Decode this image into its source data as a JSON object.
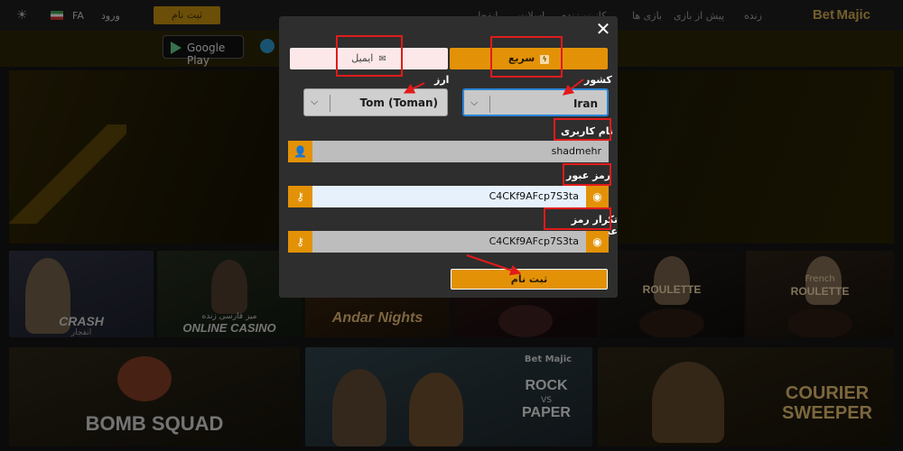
{
  "site": {
    "logo": "Bet Majic",
    "nav": [
      "زنده",
      "پیش از بازی",
      "بازی ها",
      "کازینو زنده",
      "اسلات",
      "انفجار"
    ],
    "register_button": "ثبت نام",
    "login_button": "ورود",
    "language": "FA",
    "google_play": "Google Play",
    "tiles": {
      "crash": "CRASH",
      "crash_sub": "انفجار",
      "online_casino": "ONLINE CASINO",
      "online_casino_sub": "میز فارسی زنده",
      "andar": "Andar Nights",
      "roulette2": "ROULETTE",
      "roulette3": "ROULETTE",
      "roulette3_top": "French",
      "bomb": "BOMB SQUAD",
      "rock_logo": "Bet Majic",
      "rock": "ROCK",
      "rock_vs": "VS",
      "paper": "PAPER",
      "courier": "COURIER",
      "sweeper": "SWEEPER"
    }
  },
  "modal": {
    "close": "✕",
    "tabs": {
      "email": "ایمیل",
      "fast": "سریع"
    },
    "currency": {
      "label": "ارز",
      "value": "Tom (Toman)"
    },
    "country": {
      "label": "کشور",
      "value": "Iran"
    },
    "username": {
      "label": "نام کاربری",
      "value": "shadmehr"
    },
    "password": {
      "label": "رمز عبور",
      "value": "C4CKf9AFcp7S3ta"
    },
    "password_repeat": {
      "label": "تکرار رمز عبور",
      "value": "C4CKf9AFcp7S3ta"
    },
    "submit": "ثبت نام"
  },
  "colors": {
    "accent": "#e39208",
    "annotation": "#e01b1b",
    "modal_bg": "#2e2e2e",
    "focus_border": "#2a84d6"
  },
  "icons": {
    "close": "close-icon",
    "email": "envelope-icon",
    "fast": "lightning-icon",
    "user": "user-icon",
    "key": "key-icon",
    "eye": "eye-icon",
    "chevron": "chevron-down-icon"
  }
}
